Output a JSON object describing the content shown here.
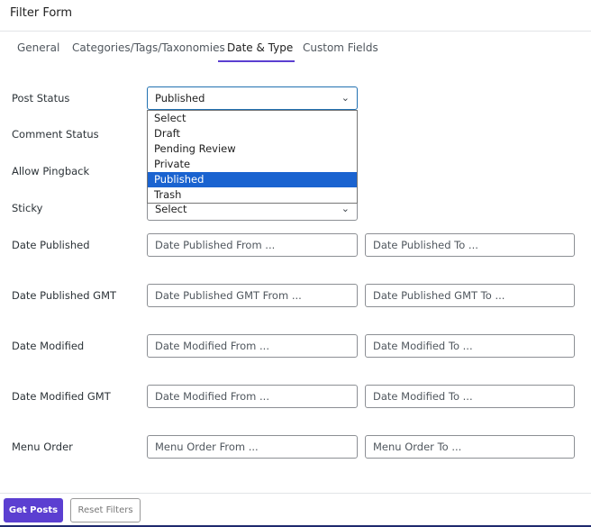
{
  "title": "Filter Form",
  "tabs": [
    "General",
    "Categories/Tags/Taxonomies",
    "Date & Type",
    "Custom Fields"
  ],
  "active_tab": "Date & Type",
  "fields": {
    "post_status": {
      "label": "Post Status",
      "value": "Published"
    },
    "post_status_options": [
      "Select",
      "Draft",
      "Pending Review",
      "Private",
      "Published",
      "Trash"
    ],
    "comment_status": {
      "label": "Comment Status"
    },
    "allow_pingback": {
      "label": "Allow Pingback"
    },
    "sticky": {
      "label": "Sticky",
      "value": "Select"
    },
    "date_published": {
      "label": "Date Published",
      "from": "Date Published From ...",
      "to": "Date Published To ..."
    },
    "date_published_gmt": {
      "label": "Date Published GMT",
      "from": "Date Published GMT From ...",
      "to": "Date Published GMT To ..."
    },
    "date_modified": {
      "label": "Date Modified",
      "from": "Date Modified From ...",
      "to": "Date Modified To ..."
    },
    "date_modified_gmt": {
      "label": "Date Modified GMT",
      "from": "Date Modified From ...",
      "to": "Date Modified To ..."
    },
    "menu_order": {
      "label": "Menu Order",
      "from": "Menu Order From ...",
      "to": "Menu Order To ..."
    }
  },
  "buttons": {
    "get_posts": "Get Posts",
    "reset": "Reset Filters"
  },
  "colors": {
    "accent": "#5b3fd1",
    "selected_option": "#1a63d0"
  }
}
